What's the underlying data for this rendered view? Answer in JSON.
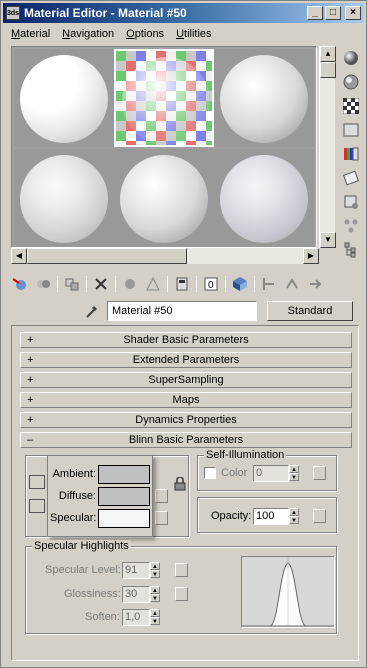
{
  "window": {
    "title": "Material Editor - Material #50",
    "app_icon_text": "3ds"
  },
  "menu": {
    "items": [
      "Material",
      "Navigation",
      "Options",
      "Utilities"
    ]
  },
  "material": {
    "name": "Material #50",
    "type": "Standard"
  },
  "rollouts": [
    {
      "sign": "+",
      "label": "Shader Basic Parameters"
    },
    {
      "sign": "+",
      "label": "Extended Parameters"
    },
    {
      "sign": "+",
      "label": "SuperSampling"
    },
    {
      "sign": "+",
      "label": "Maps"
    },
    {
      "sign": "+",
      "label": "Dynamics Properties"
    },
    {
      "sign": "–",
      "label": "Blinn Basic Parameters"
    }
  ],
  "color_popup": {
    "ambient_label": "Ambient:",
    "diffuse_label": "Diffuse:",
    "specular_label": "Specular:",
    "ambient_color": "#c0c0c0",
    "diffuse_color": "#c0c0c0",
    "specular_color": "#f5f5f5"
  },
  "self_illum": {
    "title": "Self-Illumination",
    "color_label": "Color",
    "value": "0"
  },
  "opacity": {
    "label": "Opacity:",
    "value": "100"
  },
  "specular": {
    "title": "Specular Highlights",
    "level_label": "Specular Level:",
    "level_value": "91",
    "gloss_label": "Glossiness:",
    "gloss_value": "30",
    "soften_label": "Soften:",
    "soften_value": "1,0"
  },
  "colors": {
    "title_start": "#0a246a",
    "title_end": "#a6caf0",
    "face": "#d4d0c8"
  }
}
